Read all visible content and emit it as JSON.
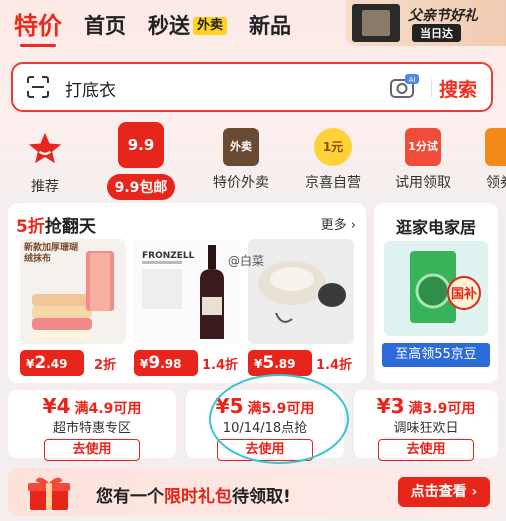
{
  "tabs": [
    {
      "label": "特价"
    },
    {
      "label": "首页"
    },
    {
      "label": "秒送"
    },
    {
      "label": "新品"
    }
  ],
  "waimai_badge": "外卖",
  "banner": {
    "title": "父亲节好礼",
    "subtitle": "当日达"
  },
  "search": {
    "text": "打底衣",
    "button": "搜索",
    "ai_label": "AI"
  },
  "categories": [
    {
      "label": "推荐",
      "icon": "star-icon"
    },
    {
      "label": "9.9包邮",
      "badge": "9.9",
      "icon": "gift-box-icon"
    },
    {
      "label": "特价外卖",
      "badge": "外卖",
      "icon": "takeout-bag-icon"
    },
    {
      "label": "京喜自营",
      "badge": "1元",
      "icon": "coin-icon"
    },
    {
      "label": "试用领取",
      "badge": "1分试",
      "icon": "shopping-bag-icon"
    },
    {
      "label": "领券",
      "icon": "coupon-icon"
    }
  ],
  "promo": {
    "title_highlight": "5折",
    "title_rest": "抢翻天",
    "more": "更多 ›",
    "products": [
      {
        "caption": "新款加厚珊瑚绒抹布",
        "yen": "¥",
        "price_int": "2",
        "price_dec": ".49",
        "discount": "2折",
        "icon": "towel-icon"
      },
      {
        "caption": "FRONZELL",
        "yen": "¥",
        "price_int": "9",
        "price_dec": ".98",
        "discount": "1.4折",
        "icon": "wine-bottle-icon"
      },
      {
        "caption": "",
        "yen": "¥",
        "price_int": "5",
        "price_dec": ".89",
        "discount": "1.4折",
        "icon": "sun-visor-icon"
      }
    ]
  },
  "home": {
    "title": "逛家电家居",
    "badge": "国补",
    "button": "至高领55京豆"
  },
  "coupons": [
    {
      "amount": "¥4",
      "condition": "满4.9可用",
      "desc": "超市特惠专区",
      "button": "去使用"
    },
    {
      "amount": "¥5",
      "condition": "满5.9可用",
      "desc": "10/14/18点抢",
      "button": "去使用"
    },
    {
      "amount": "¥3",
      "condition": "满3.9可用",
      "desc": "调味狂欢日",
      "button": "去使用"
    }
  ],
  "bottom": {
    "text_before": "您有一个",
    "text_highlight": "限时礼包",
    "text_after": "待领取!",
    "button": "点击查看 ›"
  },
  "watermark": "@白菜",
  "colors": {
    "accent": "#e8251a",
    "search_border": "#ee3b2f",
    "highlight_ring": "#39c3d3",
    "home_button": "#2b6ad8"
  }
}
